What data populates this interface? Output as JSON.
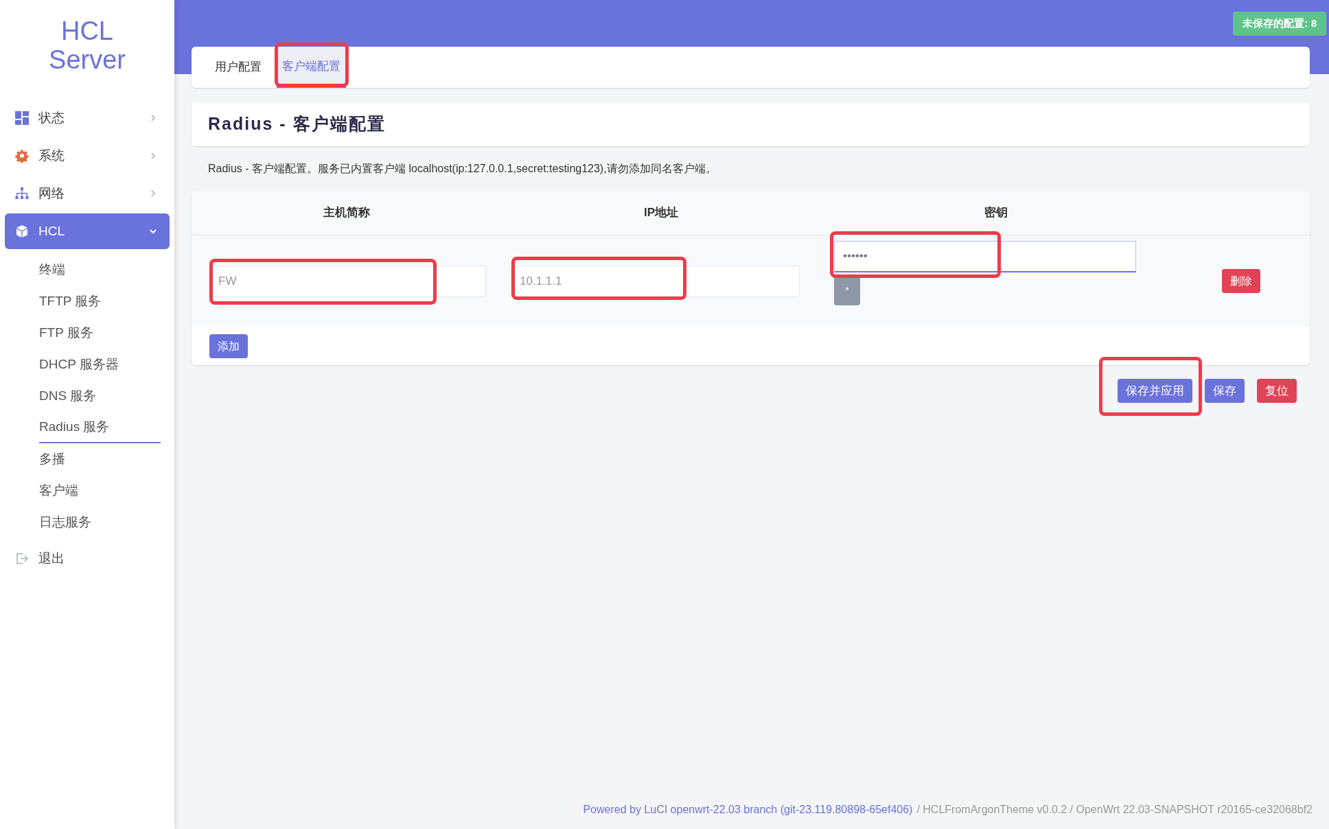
{
  "sidebar": {
    "logo_lines": [
      "HCL",
      "Server"
    ],
    "items": [
      {
        "label": "状态",
        "expanded": false,
        "selected": false
      },
      {
        "label": "系统",
        "expanded": false,
        "selected": false
      },
      {
        "label": "网络",
        "expanded": false,
        "selected": false
      },
      {
        "label": "HCL",
        "expanded": true,
        "selected": true,
        "children": [
          {
            "label": "终端",
            "selected": false
          },
          {
            "label": "TFTP 服务",
            "selected": false
          },
          {
            "label": "FTP 服务",
            "selected": false
          },
          {
            "label": "DHCP 服务器",
            "selected": false
          },
          {
            "label": "DNS 服务",
            "selected": false
          },
          {
            "label": "Radius 服务",
            "selected": true
          },
          {
            "label": "多播",
            "selected": false
          },
          {
            "label": "客户端",
            "selected": false
          },
          {
            "label": "日志服务",
            "selected": false
          }
        ]
      },
      {
        "label": "退出",
        "selected": false
      }
    ]
  },
  "unsaved_badge": "未保存的配置: 8",
  "tabs": [
    {
      "label": "用户配置",
      "selected": false,
      "highlighted": false
    },
    {
      "label": "客户端配置",
      "selected": true,
      "highlighted": true
    }
  ],
  "page_title": "Radius - 客户端配置",
  "description": "Radius - 客户端配置。服务已内置客户端 localhost(ip:127.0.0.1,secret:testing123),请勿添加同名客户端。",
  "table": {
    "columns": [
      "主机简称",
      "IP地址",
      "密钥"
    ],
    "rows": [
      {
        "host": {
          "placeholder": "FW",
          "highlighted": true
        },
        "ip": {
          "placeholder": "10.1.1.1",
          "highlighted": true
        },
        "secret": {
          "value": "••••••",
          "highlighted": true,
          "focused": true
        },
        "reveal_button": "*",
        "delete_button": "删除"
      }
    ],
    "add_button": "添加"
  },
  "actions": [
    {
      "label": "保存并应用",
      "kind": "primary",
      "highlighted": true
    },
    {
      "label": "保存",
      "kind": "primary",
      "highlighted": false
    },
    {
      "label": "复位",
      "kind": "danger",
      "highlighted": false
    }
  ],
  "footer": {
    "link": "Powered by LuCI openwrt-22.03 branch (git-23.119.80898-65ef406)",
    "rest": "/ HCLFromArgonTheme v0.0.2 / OpenWrt 22.03-SNAPSHOT r20165-ce32068bf2"
  }
}
